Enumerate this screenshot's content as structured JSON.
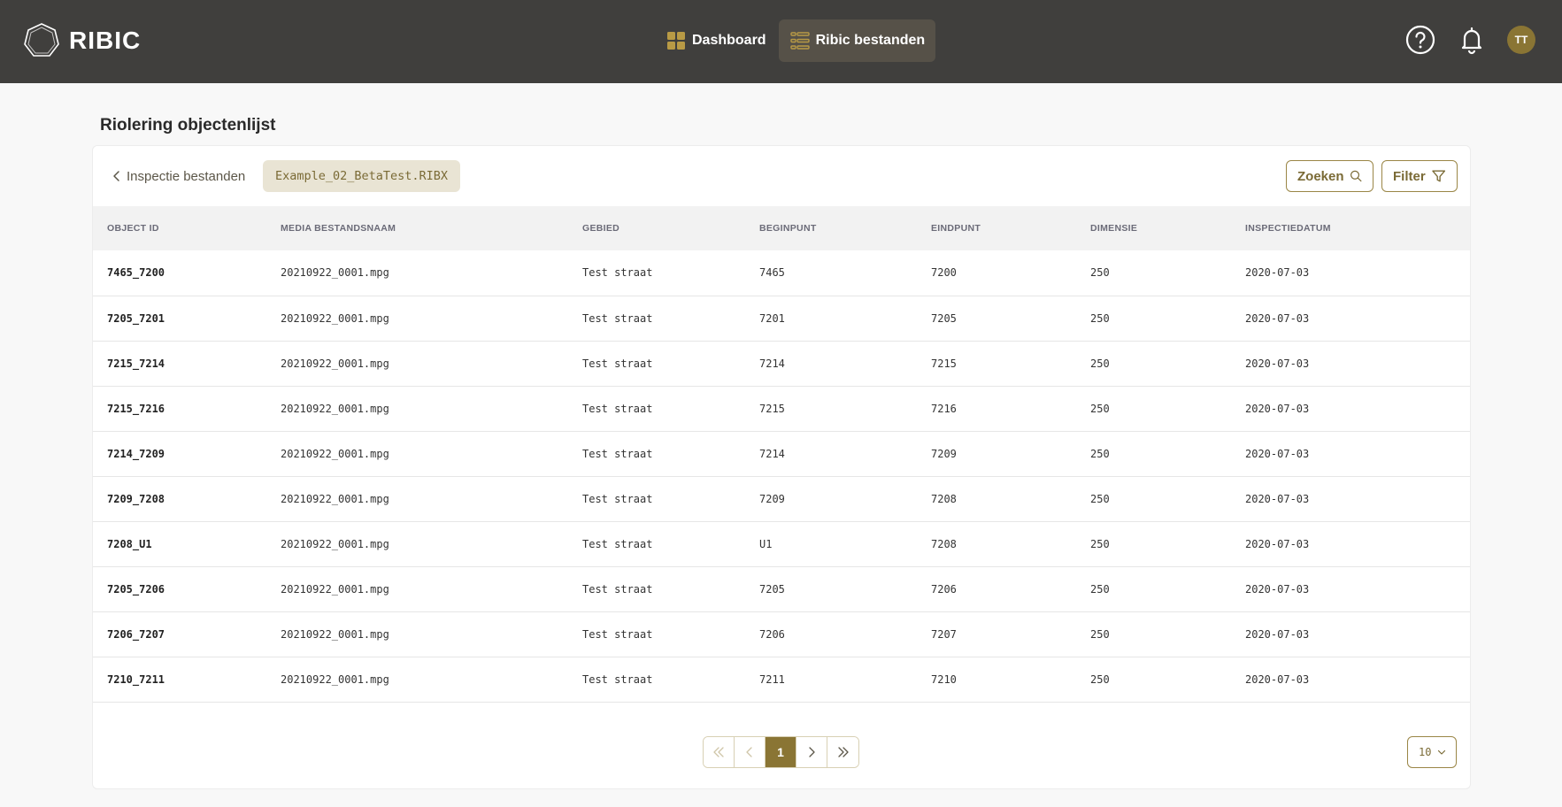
{
  "app": {
    "name": "RIBIC",
    "accent": "#8a7534",
    "topbar_bg": "#403f3d"
  },
  "nav": {
    "items": [
      {
        "label": "Dashboard",
        "icon": "grid-icon"
      },
      {
        "label": "Ribic bestanden",
        "icon": "list-icon"
      }
    ]
  },
  "user": {
    "initials": "TT"
  },
  "page": {
    "title": "Riolering objectenlijst"
  },
  "breadcrumb": {
    "back_label": "Inspectie bestanden",
    "file": "Example_02_BetaTest.RIBX"
  },
  "toolbar": {
    "search_label": "Zoeken",
    "filter_label": "Filter"
  },
  "table": {
    "headers": [
      "OBJECT ID",
      "MEDIA BESTANDSNAAM",
      "GEBIED",
      "BEGINPUNT",
      "EINDPUNT",
      "DIMENSIE",
      "INSPECTIEDATUM"
    ],
    "rows": [
      [
        "7465_7200",
        "20210922_0001.mpg",
        "Test straat",
        "7465",
        "7200",
        "250",
        "2020-07-03"
      ],
      [
        "7205_7201",
        "20210922_0001.mpg",
        "Test straat",
        "7201",
        "7205",
        "250",
        "2020-07-03"
      ],
      [
        "7215_7214",
        "20210922_0001.mpg",
        "Test straat",
        "7214",
        "7215",
        "250",
        "2020-07-03"
      ],
      [
        "7215_7216",
        "20210922_0001.mpg",
        "Test straat",
        "7215",
        "7216",
        "250",
        "2020-07-03"
      ],
      [
        "7214_7209",
        "20210922_0001.mpg",
        "Test straat",
        "7214",
        "7209",
        "250",
        "2020-07-03"
      ],
      [
        "7209_7208",
        "20210922_0001.mpg",
        "Test straat",
        "7209",
        "7208",
        "250",
        "2020-07-03"
      ],
      [
        "7208_U1",
        "20210922_0001.mpg",
        "Test straat",
        "U1",
        "7208",
        "250",
        "2020-07-03"
      ],
      [
        "7205_7206",
        "20210922_0001.mpg",
        "Test straat",
        "7205",
        "7206",
        "250",
        "2020-07-03"
      ],
      [
        "7206_7207",
        "20210922_0001.mpg",
        "Test straat",
        "7206",
        "7207",
        "250",
        "2020-07-03"
      ],
      [
        "7210_7211",
        "20210922_0001.mpg",
        "Test straat",
        "7211",
        "7210",
        "250",
        "2020-07-03"
      ]
    ]
  },
  "pagination": {
    "current_page": "1",
    "page_size": "10"
  }
}
